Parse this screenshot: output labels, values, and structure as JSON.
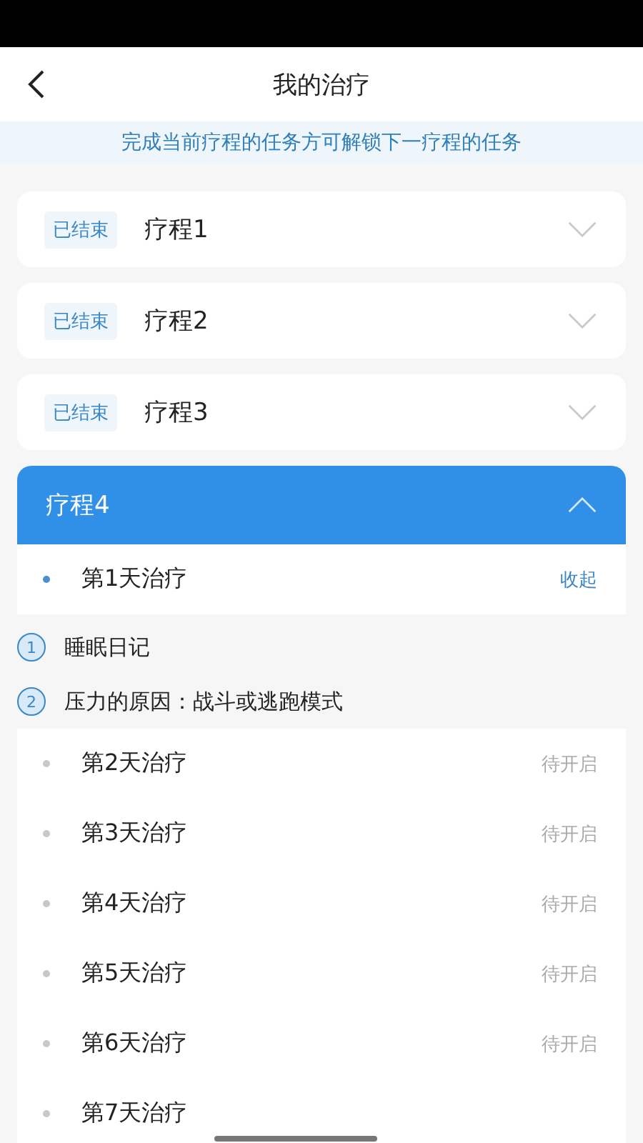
{
  "header": {
    "title": "我的治疗"
  },
  "notice": "完成当前疗程的任务方可解锁下一疗程的任务",
  "courses": [
    {
      "tag": "已结束",
      "title": "疗程1",
      "expanded": false
    },
    {
      "tag": "已结束",
      "title": "疗程2",
      "expanded": false
    },
    {
      "tag": "已结束",
      "title": "疗程3",
      "expanded": false
    },
    {
      "title": "疗程4",
      "expanded": true,
      "days": [
        {
          "title": "第1天治疗",
          "action": "收起",
          "expanded": true,
          "tasks": [
            {
              "number": "1",
              "title": "睡眠日记"
            },
            {
              "number": "2",
              "title": "压力的原因：战斗或逃跑模式"
            }
          ]
        },
        {
          "title": "第2天治疗",
          "status": "待开启",
          "expanded": false
        },
        {
          "title": "第3天治疗",
          "status": "待开启",
          "expanded": false
        },
        {
          "title": "第4天治疗",
          "status": "待开启",
          "expanded": false
        },
        {
          "title": "第5天治疗",
          "status": "待开启",
          "expanded": false
        },
        {
          "title": "第6天治疗",
          "status": "待开启",
          "expanded": false
        },
        {
          "title": "第7天治疗",
          "expanded": false
        }
      ]
    }
  ]
}
